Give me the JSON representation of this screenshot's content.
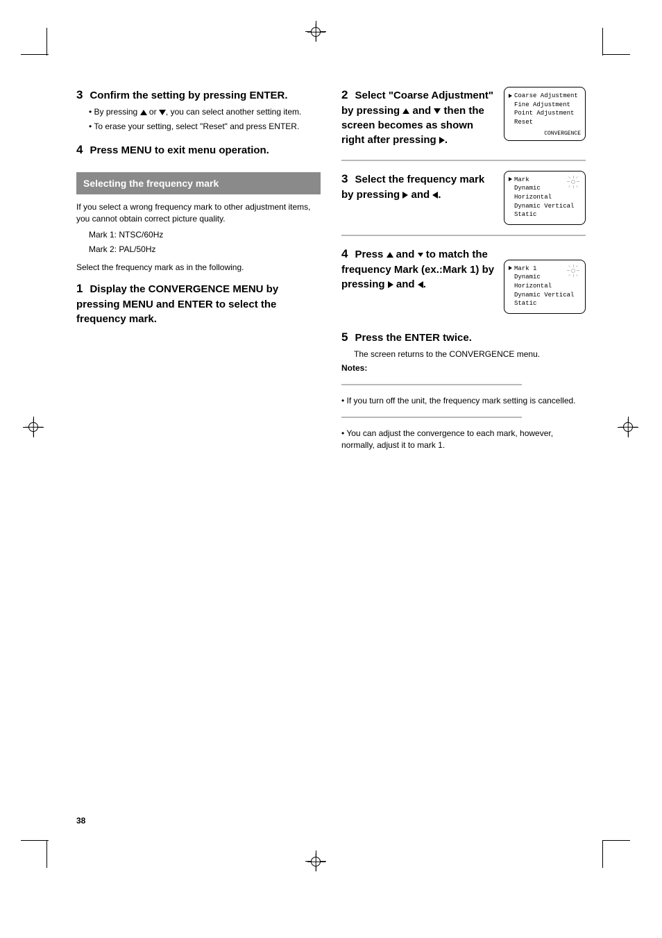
{
  "left": {
    "step3": {
      "num": "3",
      "title": "Confirm the setting by pressing ENTER.",
      "p1_pre": "• By pressing ",
      "p1_mid": " or ",
      "p1_post": ", you can select another setting item.",
      "p2": "• To erase your setting, select \"Reset\" and press ENTER."
    },
    "step4": {
      "num": "4",
      "title": "Press MENU to exit menu operation."
    },
    "bar": "Selecting the frequency mark",
    "intro": "If you select a wrong frequency mark to other adjustment items, you cannot obtain correct picture quality.",
    "freq_list": [
      "Mark 1: NTSC/60Hz",
      "Mark 2: PAL/50Hz"
    ],
    "instr_lead": "Select the frequency mark as in the following.",
    "step1": {
      "num": "1",
      "title": "Display the CONVERGENCE MENU by pressing MENU and ENTER to select the frequency mark."
    }
  },
  "right": {
    "step2": {
      "num": "2",
      "title_pre": "Select \"Coarse Adjustment\" by pressing ",
      "title_mid": " and ",
      "title_post": " then the screen becomes as shown right after pressing ",
      "title_end": "."
    },
    "screen1": {
      "line1": "Coarse Adjustment",
      "line2": "Fine Adjustment",
      "line3": "Point Adjustment",
      "line4": "Reset",
      "line5": "CONVERGENCE"
    },
    "step3": {
      "num": "3",
      "title_pre": "Select the frequency mark by pressing ",
      "title_mid": " and ",
      "title_post": "."
    },
    "screen2": {
      "line1": "Mark",
      "line2": "Dynamic Horizontal",
      "line3": "Dynamic Vertical",
      "line4": "Static"
    },
    "step4": {
      "num": "4",
      "title_pre": "Press ",
      "title_mid": " and ",
      "title_post": " to match the frequency Mark (ex.:Mark 1) by pressing ",
      "title_mid2": " and ",
      "title_end": "."
    },
    "screen3": {
      "line1": "Mark 1",
      "line2": "Dynamic Horizontal",
      "line3": "Dynamic Vertical",
      "line4": "Static"
    },
    "step5": {
      "num": "5",
      "title": "Press the ENTER twice.",
      "note": "The screen returns to the CONVERGENCE menu."
    },
    "notes": {
      "label": "Notes:",
      "n1": "• If you turn off the unit, the frequency mark setting is cancelled.",
      "n2": "• You can adjust the convergence to each mark, however, normally, adjust it to mark 1."
    }
  },
  "page_number": "38"
}
